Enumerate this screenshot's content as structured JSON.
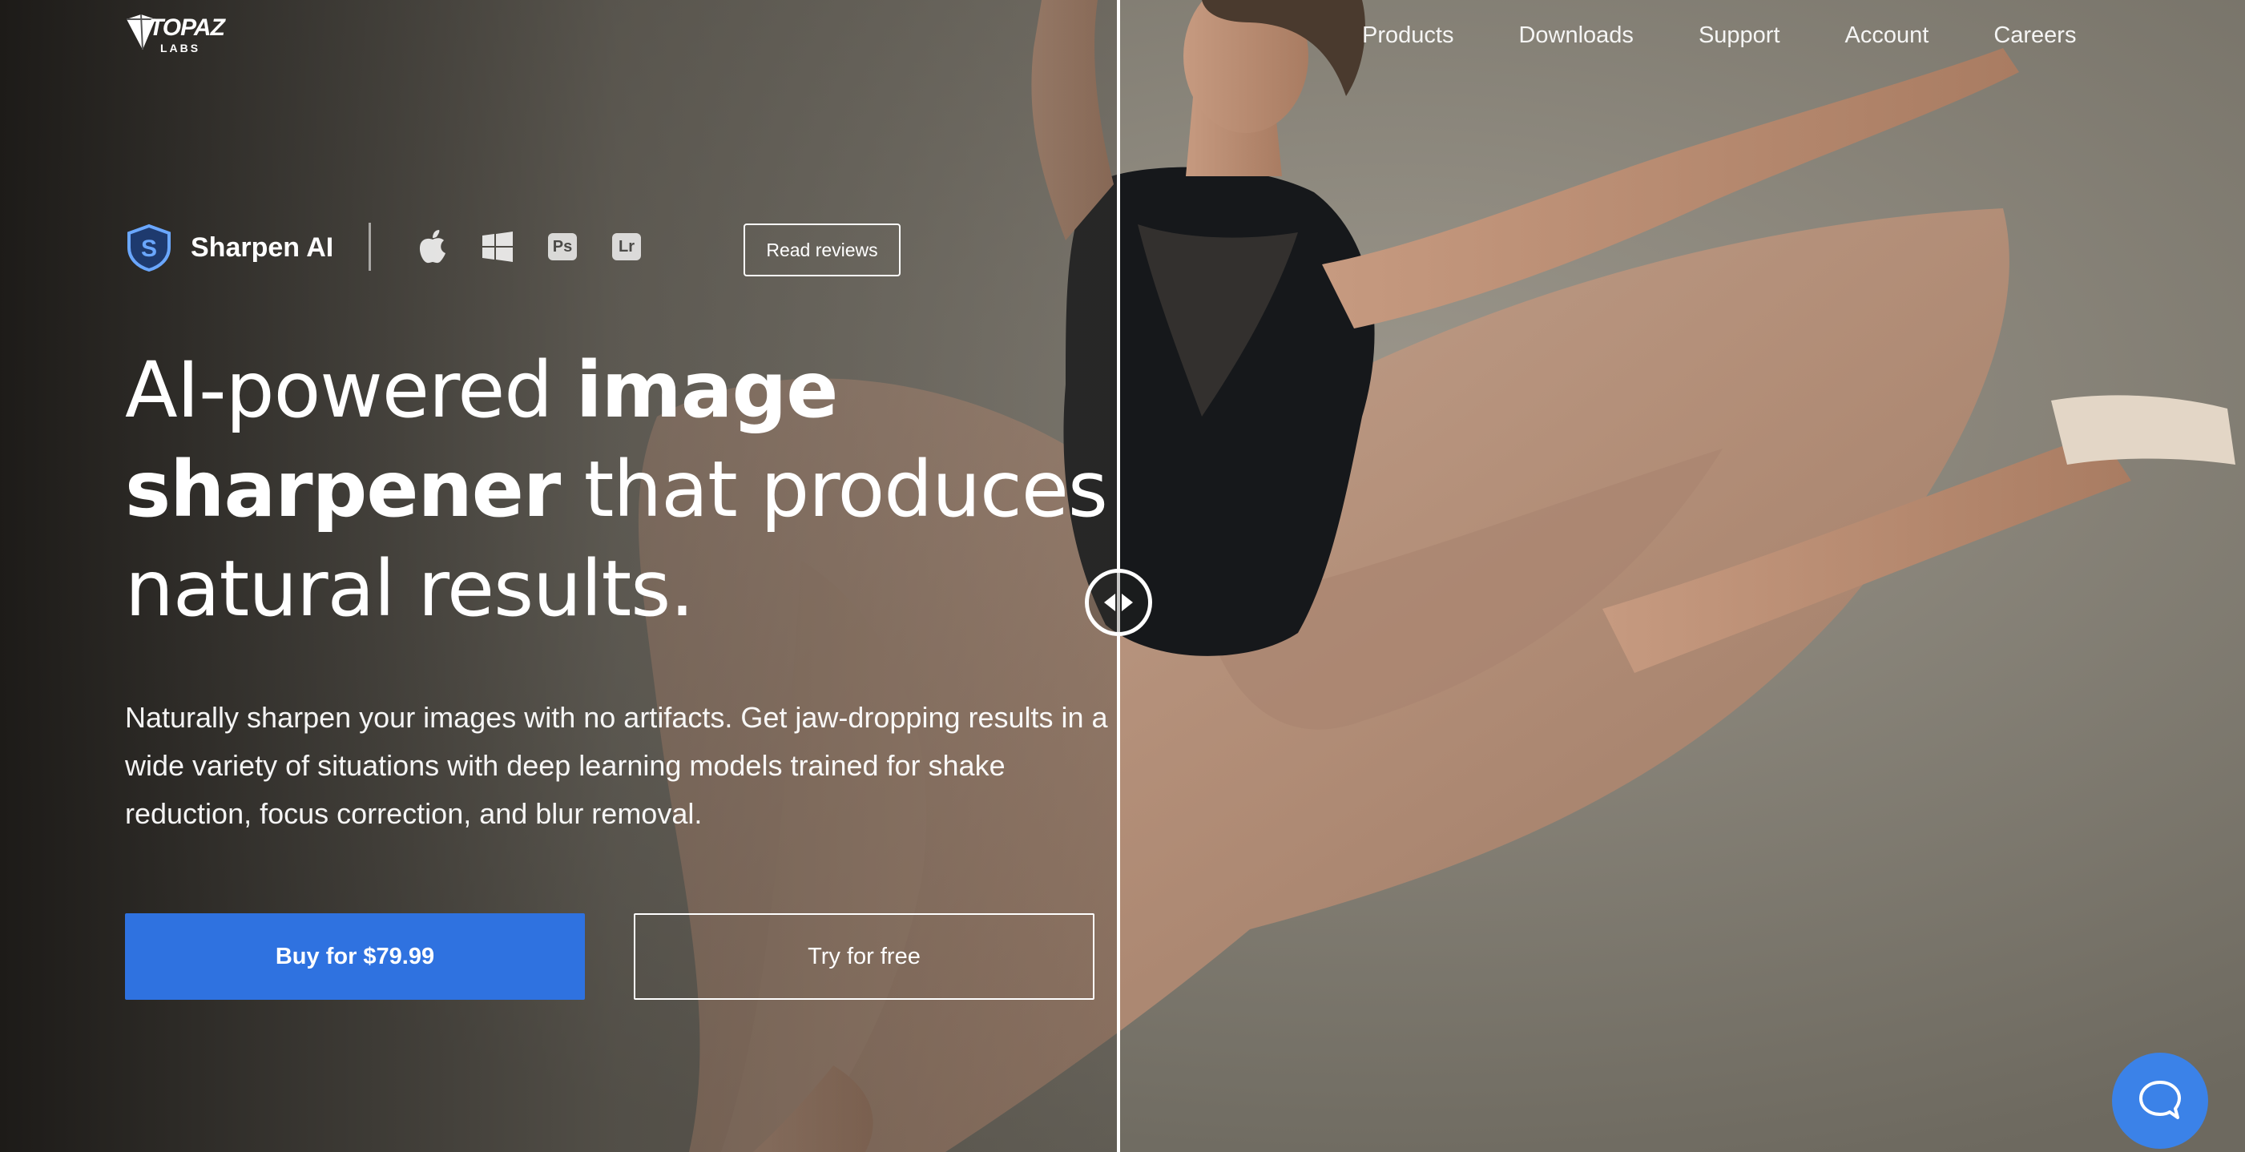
{
  "brand": {
    "logo_text": "TOPAZ",
    "logo_subtext": "LABS"
  },
  "nav": {
    "items": [
      {
        "label": "Products"
      },
      {
        "label": "Downloads"
      },
      {
        "label": "Support"
      },
      {
        "label": "Account"
      },
      {
        "label": "Careers"
      }
    ]
  },
  "product": {
    "badge_letter": "S",
    "name": "Sharpen AI",
    "platforms": [
      {
        "icon": "apple-icon"
      },
      {
        "icon": "windows-icon"
      },
      {
        "icon": "photoshop-icon",
        "label": "Ps"
      },
      {
        "icon": "lightroom-icon",
        "label": "Lr"
      }
    ],
    "read_reviews_label": "Read reviews"
  },
  "hero": {
    "headline_part1": "AI-powered ",
    "headline_bold1": "image sharpener",
    "headline_part2": " that produces natural results.",
    "subtext": "Naturally sharpen your images with no artifacts. Get jaw-dropping results in a wide variety of situations with deep learning models trained for shake reduction, focus correction, and blur removal.",
    "buy_label": "Buy for $79.99",
    "try_label": "Try for free"
  },
  "comparison": {
    "handle_icon": "left-right-arrows-icon",
    "split_fraction": 0.5
  },
  "chat": {
    "icon": "chat-bubble-icon"
  },
  "colors": {
    "accent": "#2f72e0",
    "chat": "#3b82e8",
    "badge": "#6aa7ff"
  }
}
